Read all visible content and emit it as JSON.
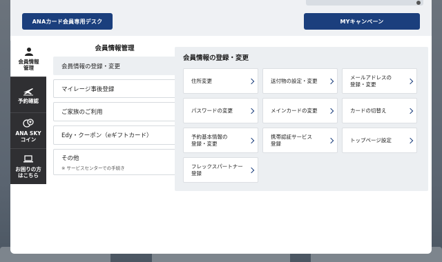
{
  "top": {
    "desk_button": "ANAカード会員専用デスク",
    "campaign_button": "MYキャンペーン"
  },
  "side_tabs": [
    {
      "label": "会員情報\n管理",
      "icon": "person-icon",
      "active": true
    },
    {
      "label": "予約確認",
      "icon": "airplane-icon",
      "active": false
    },
    {
      "label": "ANA SKY\nコイン",
      "icon": "coin-icon",
      "active": false
    },
    {
      "label": "お困りの方\nはこちら",
      "icon": "laptop-icon",
      "active": false
    }
  ],
  "menu": {
    "title": "会員情報管理",
    "items": [
      {
        "label": "会員情報の登録・変更",
        "active": true
      },
      {
        "label": "マイレージ事後登録"
      },
      {
        "label": "ご家族のご利用"
      },
      {
        "label": "Edy・クーポン（eギフトカード）"
      },
      {
        "label": "その他",
        "note": "※ サービスセンターでの手続き"
      }
    ]
  },
  "content": {
    "title": "会員情報の登録・変更",
    "cards": [
      "住所変更",
      "送付物の設定・変更",
      "メールアドレスの\n登録・変更",
      "パスワードの変更",
      "メインカードの変更",
      "カードの切替え",
      "予約基本情報の\n登録・変更",
      "携帯認証サービス\n登録",
      "トップページ設定",
      "フレックスパートナー\n登録"
    ]
  },
  "colors": {
    "navy": "#1b3f7d",
    "dark_tab": "#2f2f32",
    "panel_bg": "#eceff2"
  }
}
